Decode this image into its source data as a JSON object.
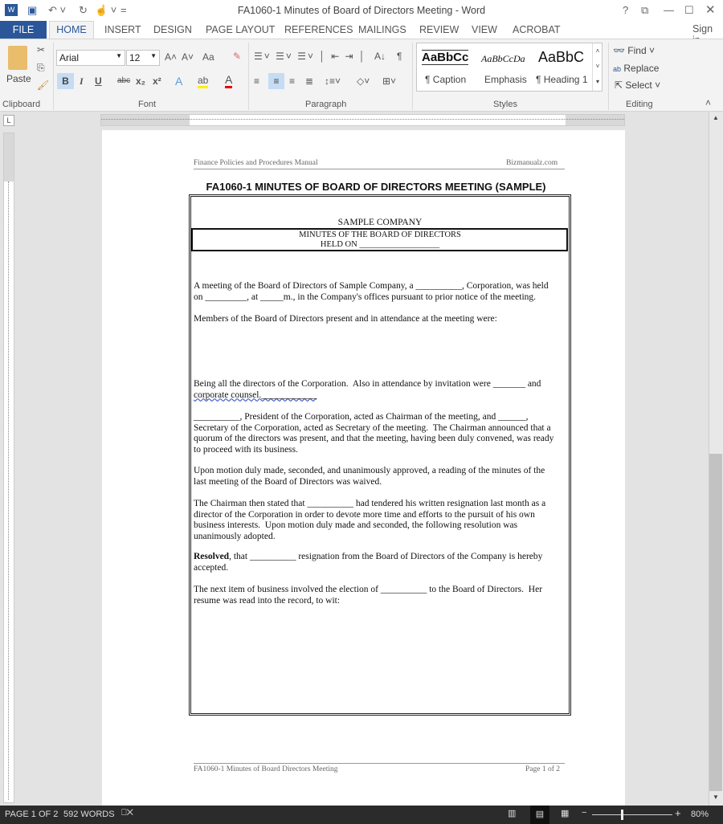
{
  "window": {
    "title": "FA1060-1 Minutes of Board of Directors Meeting - Word",
    "help": "?",
    "restore": "⧉",
    "minimize": "—",
    "maximize": "☐",
    "close": "✕"
  },
  "tabs": {
    "file": "FILE",
    "items": [
      "HOME",
      "INSERT",
      "DESIGN",
      "PAGE LAYOUT",
      "REFERENCES",
      "MAILINGS",
      "REVIEW",
      "VIEW",
      "ACROBAT"
    ],
    "sign_in": "Sign in"
  },
  "ribbon": {
    "clipboard": {
      "label": "Clipboard",
      "paste": "Paste"
    },
    "font": {
      "label": "Font",
      "name": "Arial",
      "size": "12",
      "bold": "B",
      "italic": "I",
      "underline": "U",
      "strike": "abc",
      "sub": "x₂",
      "sup": "x²",
      "grow": "A˄",
      "shrink": "A˅",
      "case": "Aa"
    },
    "paragraph": {
      "label": "Paragraph",
      "pilcrow": "¶"
    },
    "styles": {
      "label": "Styles",
      "items": [
        {
          "preview": "AaBbCc",
          "name": "¶ Caption"
        },
        {
          "preview": "AaBbCcDa",
          "name": "Emphasis"
        },
        {
          "preview": "AaBbC",
          "name": "¶ Heading 1"
        }
      ]
    },
    "editing": {
      "label": "Editing",
      "find": "Find",
      "replace": "Replace",
      "select": "Select"
    }
  },
  "document": {
    "header_left": "Finance Policies and Procedures Manual",
    "header_right": "Bizmanualz.com",
    "title": "FA1060-1 MINUTES OF BOARD OF DIRECTORS MEETING (SAMPLE)",
    "company": "SAMPLE COMPANY",
    "minutes_heading": "MINUTES OF THE BOARD OF DIRECTORS",
    "held_on": "HELD ON ___________________",
    "paragraphs": [
      [
        "A meeting of the Board of Directors of Sample Company, a __________, Corporation, was held",
        "on _________, at _____m., in the Company's offices pursuant to prior notice of the meeting."
      ],
      [
        "Members of the Board of Directors present and in attendance at the meeting were:"
      ],
      [
        "Being all the directors of the Corporation.  Also in attendance by invitation were _______ and",
        "corporate counsel.____________"
      ],
      [
        "__________, President of the Corporation, acted as Chairman of the meeting, and ______,",
        "Secretary of the Corporation, acted as Secretary of the meeting.  The Chairman announced that a",
        "quorum of the directors was present, and that the meeting, having been duly convened, was ready",
        "to proceed with its business."
      ],
      [
        "Upon motion duly made, seconded, and unanimously approved, a reading of the minutes of the",
        "last meeting of the Board of Directors was waived."
      ],
      [
        "The Chairman then stated that __________ had tendered his written resignation last month as a",
        "director of the Corporation in order to devote more time and efforts to the pursuit of his own",
        "business interests.  Upon motion duly made and seconded, the following resolution was",
        "unanimously adopted."
      ],
      [
        "__________ resignation from the Board of Directors of the Company is hereby",
        "accepted."
      ],
      [
        "The next item of business involved the election of __________ to the Board of Directors.  Her",
        "resume was read into the record, to wit:"
      ]
    ],
    "resolved_bold": "Resolved",
    "resolved_rest": ", that ",
    "footer_left": "FA1060-1 Minutes of Board Directors Meeting",
    "footer_right": "Page 1 of 2"
  },
  "status": {
    "page": "PAGE 1 OF 2",
    "words": "592 WORDS",
    "zoom": "80%",
    "zoom_level": 80
  }
}
